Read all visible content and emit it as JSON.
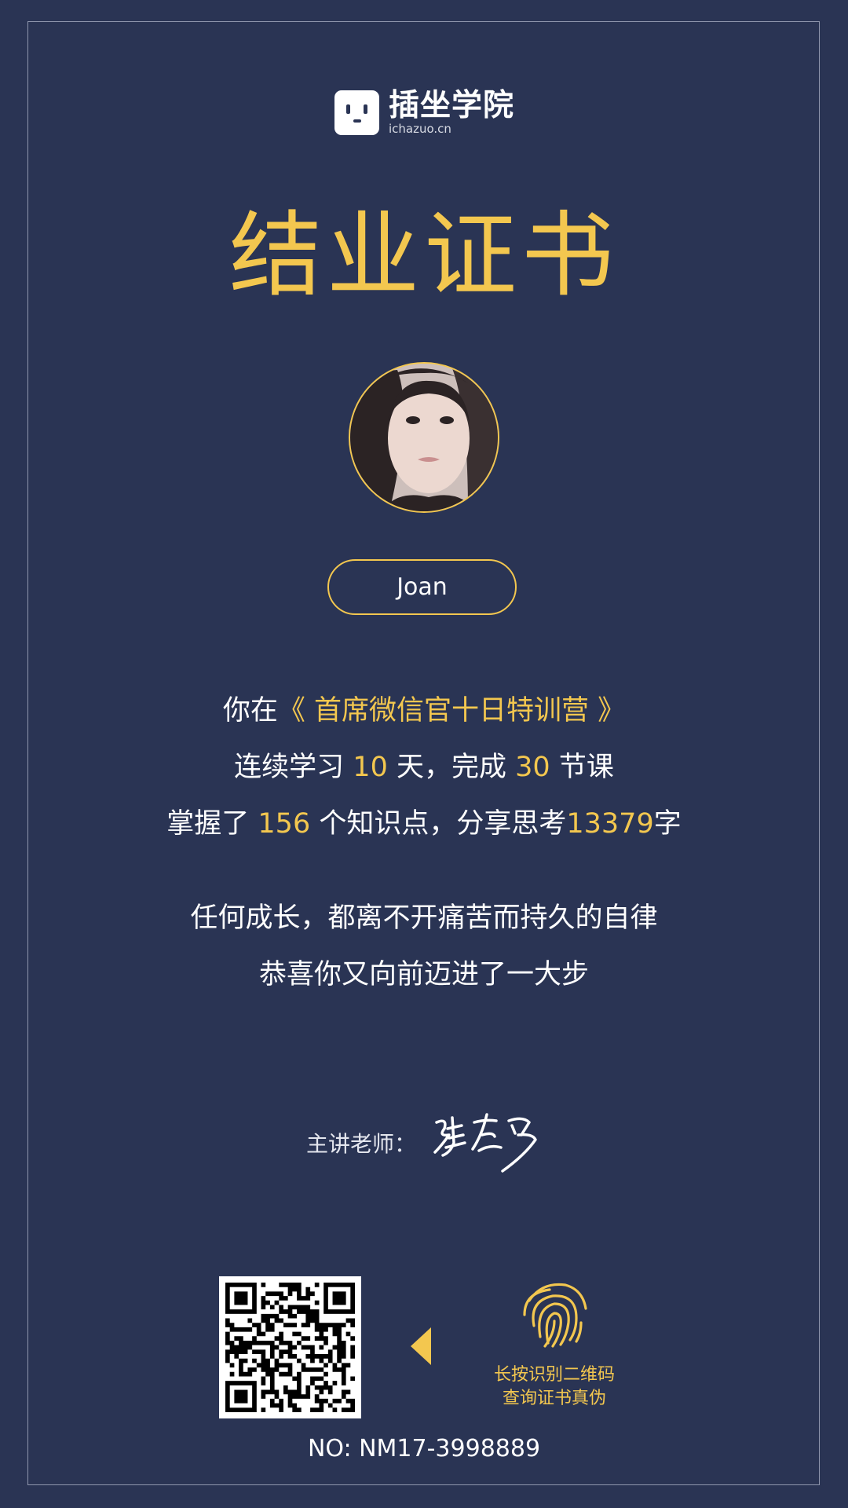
{
  "logo": {
    "name": "插坐学院",
    "domain": "ichazuo.cn"
  },
  "certificate": {
    "title": "结业证书",
    "student_name": "Joan"
  },
  "summary": {
    "line1_prefix": "你在",
    "course": "《 首席微信官十日特训营 》",
    "line2_a": "连续学习",
    "days": "10",
    "line2_b": "天，完成",
    "lessons": "30",
    "line2_c": "节课",
    "line3_a": "掌握了",
    "knowledge_points": "156",
    "line3_b": "个知识点，分享思考",
    "characters": "13379",
    "line3_c": "字",
    "motto1": "任何成长，都离不开痛苦而持久的自律",
    "motto2": "恭喜你又向前迈进了一大步"
  },
  "teacher": {
    "label": "主讲老师："
  },
  "verify": {
    "hint1": "长按识别二维码",
    "hint2": "查询证书真伪"
  },
  "cert_no": "NO: NM17-3998889",
  "colors": {
    "background": "#2a3454",
    "accent": "#f3c74f",
    "frame": "#8f96ad"
  },
  "icons": [
    "logo-badge-icon",
    "qr-code",
    "left-arrow-icon",
    "fingerprint-icon",
    "signature"
  ]
}
